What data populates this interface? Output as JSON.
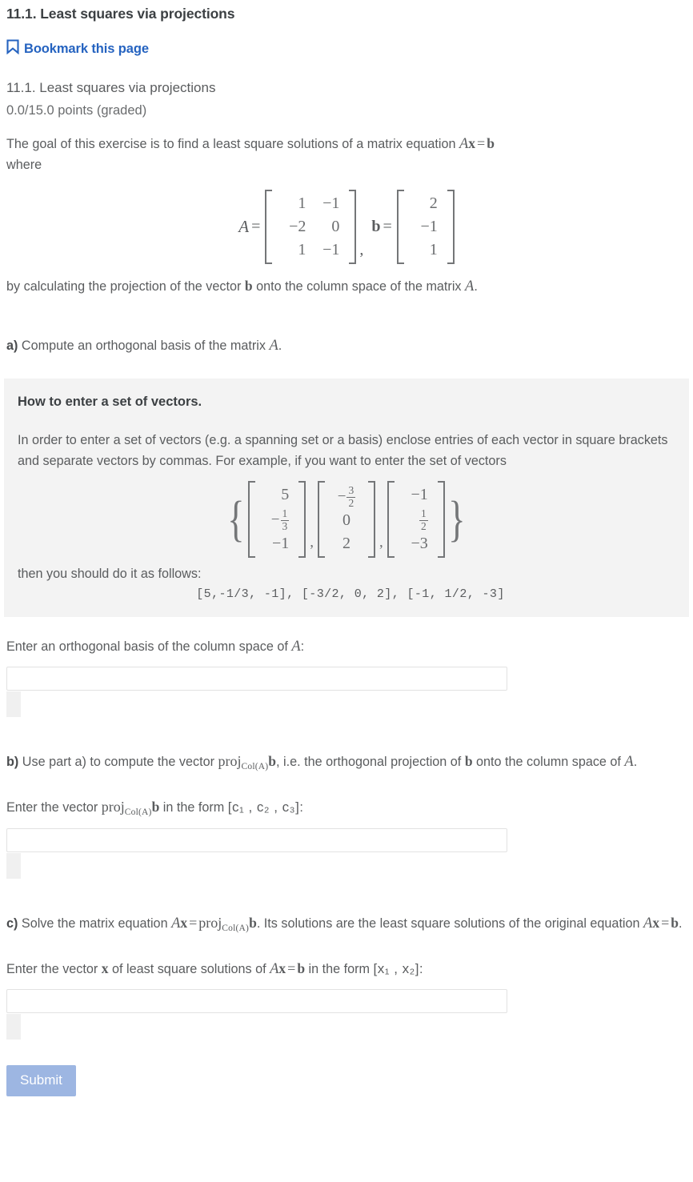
{
  "header": {
    "unit_title": "11.1. Least squares via projections",
    "bookmark_label": "Bookmark this page",
    "bookmark_icon": "bookmark-icon",
    "accent_blue": "#2563c0"
  },
  "problem": {
    "title": "11.1. Least squares via projections",
    "points": "0.0/15.0 points (graded)",
    "intro_pre": "The goal of this exercise is to find a least square solutions of a matrix equation ",
    "intro_eq_A": "A",
    "intro_eq_x": "x",
    "intro_eq_equals": "=",
    "intro_eq_b": "b",
    "intro_where": "where",
    "after_matrices_pre": "by calculating the projection of the vector ",
    "after_matrices_b": "b",
    "after_matrices_mid": " onto the column space of the matrix ",
    "after_matrices_A": "A",
    "after_matrices_end": "."
  },
  "matrices": {
    "A_label": "A",
    "A_equals": "=",
    "A_rows": [
      [
        "1",
        "−1"
      ],
      [
        "−2",
        "0"
      ],
      [
        "1",
        "−1"
      ]
    ],
    "separator": ",",
    "b_label": "b",
    "b_equals": "=",
    "b_rows": [
      [
        "2"
      ],
      [
        "−1"
      ],
      [
        "1"
      ]
    ]
  },
  "part_a": {
    "marker": "a)",
    "text_pre": " Compute an orthogonal basis of the matrix ",
    "text_math": "A",
    "text_end": ".",
    "prompt_pre": "Enter an orthogonal basis of the column space of ",
    "prompt_math": "A",
    "prompt_end": ":",
    "input_value": "",
    "input_placeholder": ""
  },
  "infobox": {
    "title": "How to enter a set of vectors.",
    "paragraph": "In order to enter a set of vectors (e.g. a spanning set or a basis) enclose entries of each vector in square brackets and separate vectors by commas. For example, if you want to enter the set of vectors",
    "vector_set": [
      [
        "5",
        "-1/3",
        "−1"
      ],
      [
        "-3/2",
        "0",
        "2"
      ],
      [
        "−1",
        "1/2",
        "−3"
      ]
    ],
    "follow_text": "then you should do it as follows:",
    "mono_example": "[5,-1/3, -1], [-3/2, 0, 2], [-1, 1/2, -3]",
    "background": "#f3f3f3"
  },
  "part_b": {
    "marker": "b)",
    "text_pre": " Use part a) to compute the vector ",
    "proj_op": "proj",
    "proj_sub": "Col(A)",
    "proj_vec": "b",
    "text_mid": ", i.e. the orthogonal projection of ",
    "text_b": "b",
    "text_mid2": " onto the column space of ",
    "text_A": "A",
    "text_end": ".",
    "prompt_pre": "Enter the vector ",
    "prompt_mid": " in the form ",
    "prompt_form": "[c₁ , c₂ , c₃]",
    "prompt_end": ":",
    "input_value": "",
    "input_placeholder": ""
  },
  "part_c": {
    "marker": "c)",
    "text_pre": " Solve the matrix equation ",
    "eq_Ax": "Ax",
    "eq_equals": "=",
    "proj_op": "proj",
    "proj_sub": "Col(A)",
    "proj_vec": "b",
    "text_mid": ". Its solutions are the least square solutions of the original equation ",
    "eq2_Ax": "Ax",
    "eq2_equals": "=",
    "eq2_b": "b",
    "text_end": ".",
    "prompt_pre": "Enter the vector ",
    "prompt_x": "x",
    "prompt_mid": " of least square solutions of ",
    "prompt_eq": "Ax = b",
    "prompt_mid2": " in the form ",
    "prompt_form": "[x₁ , x₂]",
    "prompt_end": ":",
    "input_value": "",
    "input_placeholder": ""
  },
  "footer": {
    "submit_label": "Submit",
    "submit_color": "#9db6e2"
  }
}
